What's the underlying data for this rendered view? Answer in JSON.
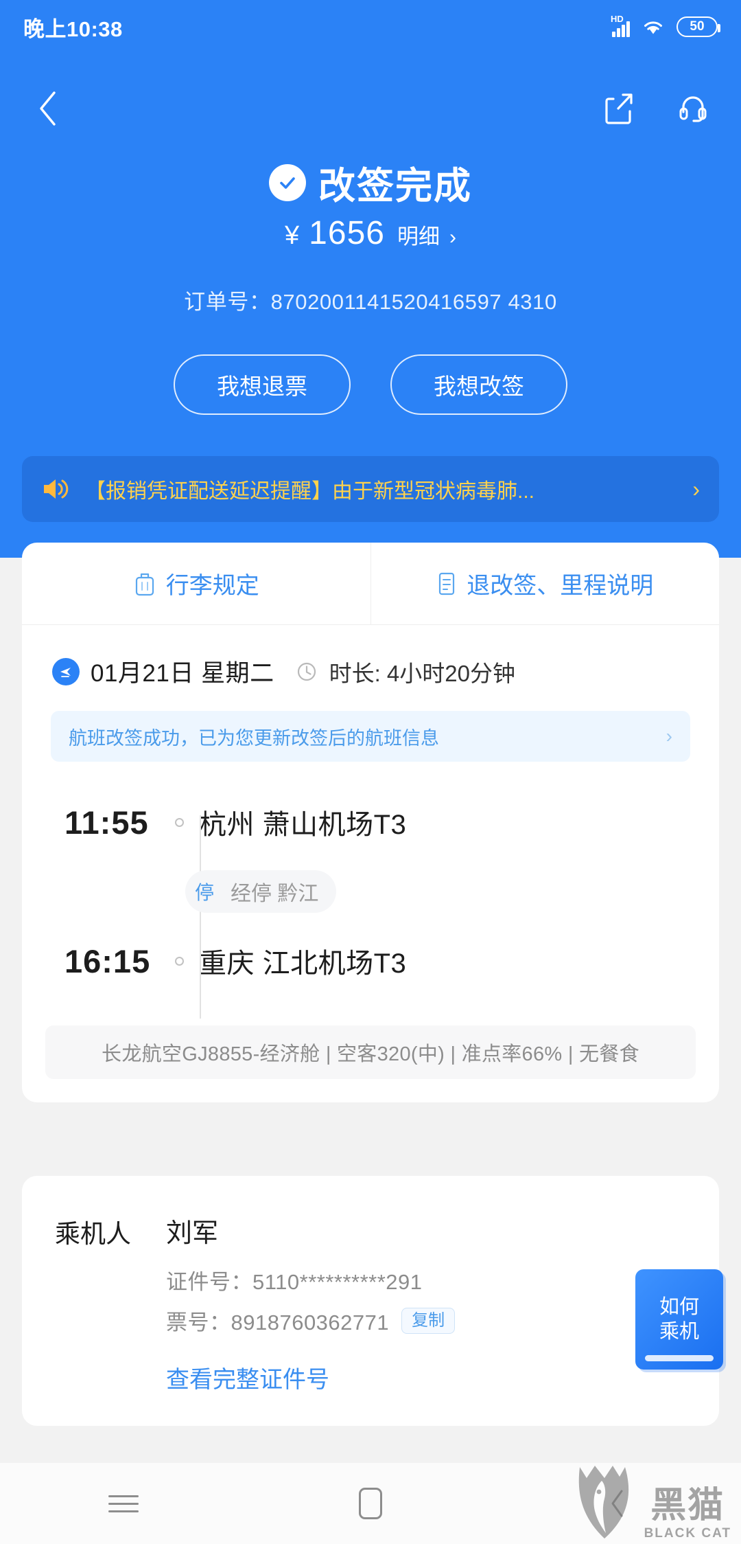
{
  "status_bar": {
    "time": "晚上10:38",
    "network_label": "HD",
    "battery_level": "50"
  },
  "header": {
    "back_icon": "chevron-left-icon",
    "share_icon": "share-icon",
    "support_icon": "headset-icon",
    "title": "改签完成",
    "status_icon": "check-circle-icon",
    "currency_symbol": "¥",
    "price": "1656",
    "price_detail_label": "明细",
    "price_detail_chevron": "›",
    "order_number": "订单号：8702001141520416597 4310",
    "buttons": [
      {
        "label": "我想退票",
        "name": "refund-button"
      },
      {
        "label": "我想改签",
        "name": "change-ticket-button"
      }
    ]
  },
  "notice": {
    "icon": "speaker-icon",
    "text": "【报销凭证配送延迟提醒】由于新型冠状病毒肺...",
    "chevron": "›"
  },
  "flight_card": {
    "tabs": [
      {
        "label": "行李规定",
        "icon": "luggage-icon"
      },
      {
        "label": "退改签、里程说明",
        "icon": "document-list-icon"
      }
    ],
    "date": "01月21日  星期二",
    "duration": "时长: 4小时20分钟",
    "plane_icon": "airplane-icon",
    "clock_icon": "clock-icon",
    "change_notice": {
      "text": "航班改签成功，已为您更新改签后的航班信息",
      "chevron": "›"
    },
    "departure": {
      "time": "11:55",
      "place": "杭州 萧山机场T3"
    },
    "stopover": {
      "badge": "停",
      "text": "经停 黔江"
    },
    "arrival": {
      "time": "16:15",
      "place": "重庆 江北机场T3"
    },
    "flight_info": "长龙航空GJ8855-经济舱 | 空客320(中) | 准点率66% | 无餐食"
  },
  "passenger_card": {
    "label": "乘机人",
    "name": "刘军",
    "id_number": "证件号：5110**********291",
    "ticket_number": "票号：8918760362771",
    "copy_label": "复制",
    "view_full_id_link": "查看完整证件号",
    "howto_line1": "如何",
    "howto_line2": "乘机"
  },
  "bottom_nav": {
    "menu_icon": "menu-icon",
    "home_icon": "home-icon",
    "back_icon": "chevron-left-icon"
  },
  "watermark": {
    "cn": "黑猫",
    "en": "BLACK CAT"
  },
  "colors": {
    "brand_blue": "#2b82f6",
    "accent_yellow": "#ffd24d",
    "link_blue": "#3a8ef0",
    "page_bg": "#f2f2f2"
  }
}
